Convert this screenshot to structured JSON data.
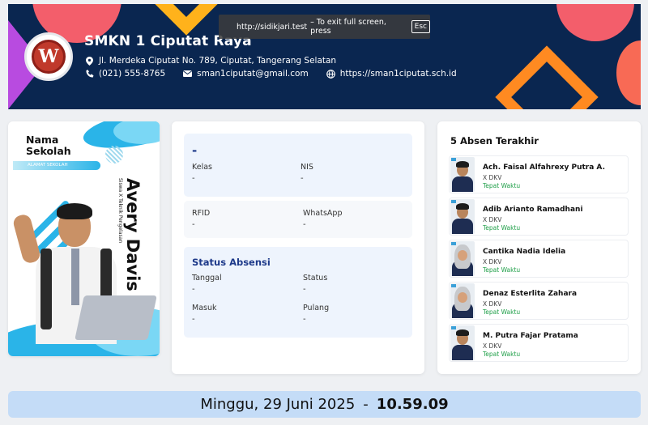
{
  "browser": {
    "fullscreen_url": "http://sidikjari.test",
    "fullscreen_hint": "– To exit full screen, press",
    "esc_key": "Esc"
  },
  "header": {
    "school_name": "SMKN 1 Ciputat Raya",
    "address": "Jl. Merdeka Ciputat No. 789, Ciputat, Tangerang Selatan",
    "phone": "(021) 555-8765",
    "email": "sman1ciputat@gmail.com",
    "website": "https://sman1ciputat.sch.id",
    "logo_text": "W"
  },
  "id_card": {
    "label_name": "Nama",
    "label_school": "Sekolah",
    "address_label": "ALAMAT SEKOLAH",
    "student_name": "Avery Davis",
    "student_sub": "Siswa X Teknik Pengelasan"
  },
  "student": {
    "name": "-",
    "kelas_label": "Kelas",
    "kelas": "-",
    "nis_label": "NIS",
    "nis": "-",
    "rfid_label": "RFID",
    "rfid": "-",
    "whatsapp_label": "WhatsApp",
    "whatsapp": "-"
  },
  "status": {
    "title": "Status Absensi",
    "tanggal_label": "Tanggal",
    "tanggal": "-",
    "status_label": "Status",
    "status": "-",
    "masuk_label": "Masuk",
    "masuk": "-",
    "pulang_label": "Pulang",
    "pulang": "-"
  },
  "recent": {
    "title": "5 Absen Terakhir",
    "items": [
      {
        "name": "Ach. Faisal Alfahrexy Putra A.",
        "kelas": "X DKV",
        "status": "Tepat Waktu"
      },
      {
        "name": "Adib Arianto Ramadhani",
        "kelas": "X DKV",
        "status": "Tepat Waktu"
      },
      {
        "name": "Cantika Nadia Idelia",
        "kelas": "X DKV",
        "status": "Tepat Waktu"
      },
      {
        "name": "Denaz Esterlita Zahara",
        "kelas": "X DKV",
        "status": "Tepat Waktu"
      },
      {
        "name": "M. Putra Fajar Pratama",
        "kelas": "X DKV",
        "status": "Tepat Waktu"
      }
    ]
  },
  "footer": {
    "date": "Minggu, 29 Juni 2025",
    "separator": "-",
    "time": "10.59.09"
  },
  "colors": {
    "header_bg": "#0a2650",
    "accent_blue": "#1e3a8a",
    "status_green": "#21a04a",
    "footer_bg": "#c4dcf7"
  }
}
